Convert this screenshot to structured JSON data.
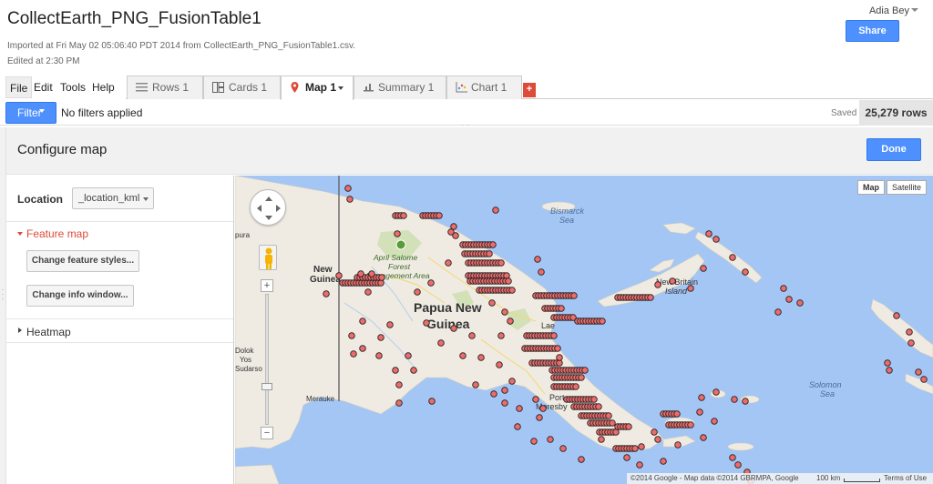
{
  "header": {
    "title": "CollectEarth_PNG_FusionTable1",
    "imported": "Imported at Fri May 02 05:06:40 PDT 2014 from CollectEarth_PNG_FusionTable1.csv.",
    "edited": "Edited at 2:30 PM",
    "user": "Adia Bey",
    "share_label": "Share"
  },
  "menu": [
    "File",
    "Edit",
    "Tools",
    "Help"
  ],
  "tabs": [
    {
      "label": "Rows 1",
      "icon": "rows-icon"
    },
    {
      "label": "Cards 1",
      "icon": "cards-icon"
    },
    {
      "label": "Map 1",
      "icon": "map-pin-icon",
      "active": true
    },
    {
      "label": "Summary 1",
      "icon": "summary-icon"
    },
    {
      "label": "Chart 1",
      "icon": "chart-icon"
    }
  ],
  "add_tab_label": "+",
  "filter": {
    "button_label": "Filter",
    "status": "No filters applied",
    "saved": "Saved",
    "rows": "25,279 rows"
  },
  "configure": {
    "title": "Configure map",
    "done_label": "Done",
    "location_label": "Location",
    "location_value": "_location_kml",
    "feature_map_label": "Feature map",
    "feature_styles_label": "Change feature styles...",
    "info_window_label": "Change info window...",
    "heatmap_label": "Heatmap"
  },
  "map": {
    "map_type_map": "Map",
    "map_type_satellite": "Satellite",
    "labels": {
      "bismarck1": "Bismarck",
      "bismarck2": "Sea",
      "april1": "April Salome",
      "april2": "Forest",
      "april3": "Management Area",
      "newguinea1": "New",
      "newguinea2": "Guinea",
      "png1": "Papua New",
      "png2": "Guinea",
      "nbi1": "New Britain",
      "nbi2": "Island",
      "lae": "Lae",
      "port1": "Port",
      "port2": "Moresby",
      "solomon1": "Solomon",
      "solomon2": "Sea",
      "merauke": "Merauke",
      "dolok": "Dolok",
      "yos": "Yos",
      "sudarso": "Sudarso",
      "jayapura": "pura"
    },
    "attribution": "©2014 Google - Map data ©2014 GBRMPA, Google",
    "scale": "100 km",
    "terms": "Terms of Use",
    "water_color": "#a4c6f4",
    "land_color": "#efebe2",
    "marker_color": "#ee6b6b"
  }
}
